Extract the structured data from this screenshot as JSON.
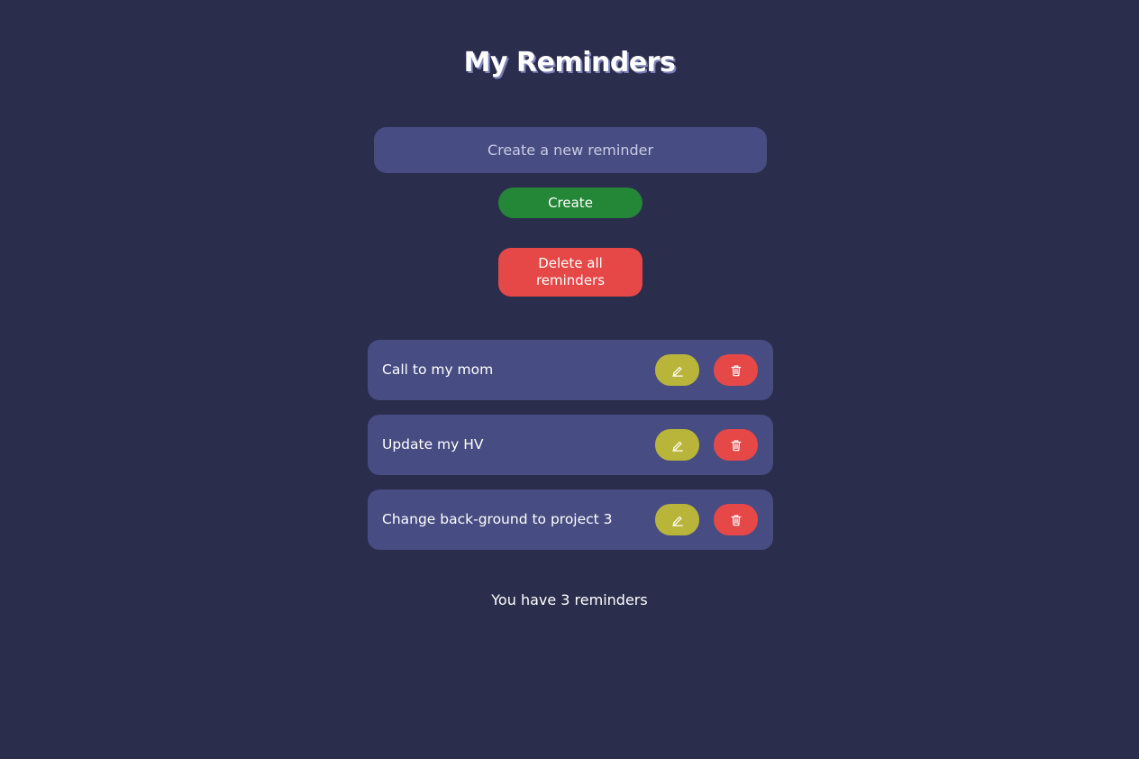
{
  "header": {
    "title": "My Reminders"
  },
  "form": {
    "input_placeholder": "Create a new reminder",
    "input_value": "",
    "create_label": "Create",
    "delete_all_label": "Delete all reminders"
  },
  "reminders": [
    {
      "text": "Call to my mom",
      "edit_icon": "pencil-icon",
      "delete_icon": "trash-icon"
    },
    {
      "text": "Update my HV",
      "edit_icon": "pencil-icon",
      "delete_icon": "trash-icon"
    },
    {
      "text": "Change back-ground to project 3",
      "edit_icon": "pencil-icon",
      "delete_icon": "trash-icon"
    }
  ],
  "footer": {
    "count_text": "You have 3 reminders"
  },
  "colors": {
    "background": "#2b2d4c",
    "card": "#474c82",
    "create": "#248637",
    "delete": "#e64747",
    "edit": "#b8b53a"
  }
}
